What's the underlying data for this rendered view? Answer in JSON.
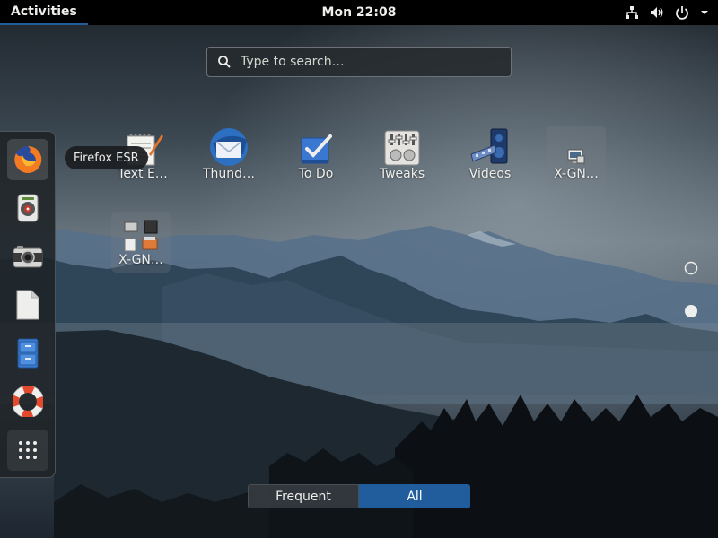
{
  "topbar": {
    "activities_label": "Activities",
    "clock": "Mon 22:08",
    "tray_icons": [
      "network-icon",
      "volume-icon",
      "power-icon",
      "menu-arrow-icon"
    ]
  },
  "search": {
    "placeholder": "Type to search…"
  },
  "dash": {
    "items": [
      {
        "app": "Firefox ESR",
        "icon": "firefox-icon",
        "active": true
      },
      {
        "icon": "sound-juicer-icon"
      },
      {
        "icon": "camera-icon"
      },
      {
        "icon": "document-icon"
      },
      {
        "icon": "file-cabinet-icon"
      },
      {
        "icon": "help-lifebuoy-icon"
      },
      {
        "icon": "show-apps-grid-icon"
      }
    ],
    "tooltip": "Firefox ESR"
  },
  "apps": [
    {
      "label": "Text E…",
      "icon": "text-editor-icon"
    },
    {
      "label": "Thund…",
      "icon": "thunderbird-icon"
    },
    {
      "label": "To Do",
      "icon": "todo-icon"
    },
    {
      "label": "Tweaks",
      "icon": "tweaks-icon"
    },
    {
      "label": "Videos",
      "icon": "videos-icon"
    },
    {
      "label": "X-GN…",
      "icon": "xgnome-display-icon"
    },
    {
      "label": "X-GN…",
      "icon": "xgnome-folder-icon"
    }
  ],
  "pagination": {
    "pages": 2,
    "current": 2
  },
  "switcher": {
    "frequent_label": "Frequent",
    "all_label": "All",
    "selected": "All"
  },
  "colors": {
    "accent": "#215d9c",
    "topbar": "#000000",
    "text": "#eeeeec"
  }
}
